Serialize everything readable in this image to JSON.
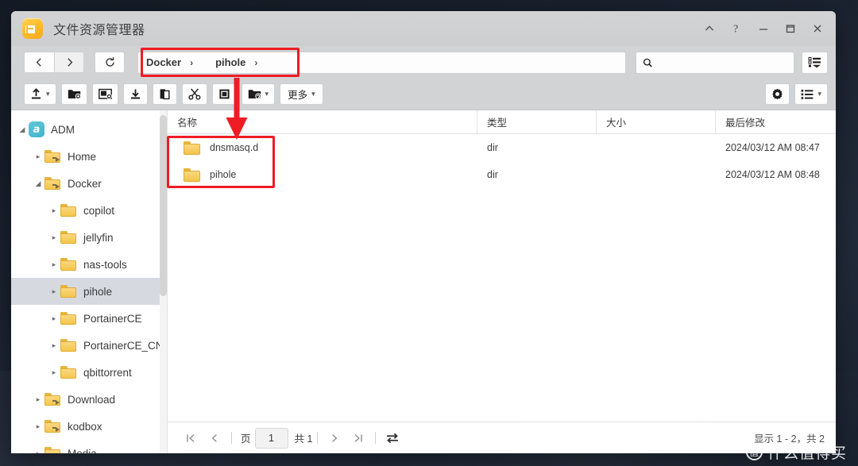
{
  "window": {
    "title": "文件资源管理器",
    "app_icon": "file-explorer-icon",
    "controls": {
      "collapse": "chevron-up-icon",
      "help": "help-icon",
      "minimize": "minimize-icon",
      "maximize": "maximize-icon",
      "close": "close-icon"
    }
  },
  "navbar": {
    "back": "back-icon",
    "forward": "forward-icon",
    "reload": "reload-icon",
    "breadcrumb": [
      {
        "label": "Docker",
        "sep": "›"
      },
      {
        "label": "pihole",
        "sep": "›"
      }
    ],
    "search": {
      "placeholder": "",
      "value": "",
      "icon": "search-icon"
    },
    "filter_button": "filter-list-icon"
  },
  "toolbar": {
    "buttons": [
      {
        "name": "upload",
        "icon": "upload-icon",
        "label": "",
        "caret": true
      },
      {
        "name": "new-folder",
        "icon": "new-folder-icon",
        "label": "",
        "caret": false
      },
      {
        "name": "new-shared-folder",
        "icon": "shared-folder-icon",
        "label": "",
        "caret": false
      },
      {
        "name": "download",
        "icon": "download-icon",
        "label": "",
        "caret": false
      },
      {
        "name": "copy",
        "icon": "copy-icon",
        "label": "",
        "caret": false
      },
      {
        "name": "cut",
        "icon": "scissors-icon",
        "label": "",
        "caret": false
      },
      {
        "name": "paste",
        "icon": "paste-icon",
        "label": "",
        "caret": false
      },
      {
        "name": "share",
        "icon": "share-icon",
        "label": "",
        "caret": true
      },
      {
        "name": "more",
        "icon": "",
        "label": "更多",
        "caret": true
      }
    ],
    "settings_button": "gear-icon",
    "view_button": "list-view-icon"
  },
  "sidebar": {
    "items": [
      {
        "label": "ADM",
        "indent": 0,
        "icon": "adm-icon",
        "twisty": "expanded",
        "selected": false
      },
      {
        "label": "Home",
        "indent": 1,
        "icon": "shared-folder-icon",
        "twisty": "collapsed",
        "selected": false
      },
      {
        "label": "Docker",
        "indent": 1,
        "icon": "shared-folder-icon",
        "twisty": "expanded",
        "selected": false
      },
      {
        "label": "copilot",
        "indent": 2,
        "icon": "folder-icon",
        "twisty": "collapsed",
        "selected": false
      },
      {
        "label": "jellyfin",
        "indent": 2,
        "icon": "folder-icon",
        "twisty": "collapsed",
        "selected": false
      },
      {
        "label": "nas-tools",
        "indent": 2,
        "icon": "folder-icon",
        "twisty": "collapsed",
        "selected": false
      },
      {
        "label": "pihole",
        "indent": 2,
        "icon": "folder-icon",
        "twisty": "collapsed",
        "selected": true
      },
      {
        "label": "PortainerCE",
        "indent": 2,
        "icon": "folder-icon",
        "twisty": "collapsed",
        "selected": false
      },
      {
        "label": "PortainerCE_CN",
        "indent": 2,
        "icon": "folder-icon",
        "twisty": "collapsed",
        "selected": false
      },
      {
        "label": "qbittorrent",
        "indent": 2,
        "icon": "folder-icon",
        "twisty": "collapsed",
        "selected": false
      },
      {
        "label": "Download",
        "indent": 1,
        "icon": "shared-folder-icon",
        "twisty": "collapsed",
        "selected": false
      },
      {
        "label": "kodbox",
        "indent": 1,
        "icon": "shared-folder-icon",
        "twisty": "collapsed",
        "selected": false
      },
      {
        "label": "Media",
        "indent": 1,
        "icon": "shared-folder-icon",
        "twisty": "collapsed",
        "selected": false
      }
    ]
  },
  "filelist": {
    "columns": [
      {
        "key": "name",
        "label": "名称"
      },
      {
        "key": "type",
        "label": "类型"
      },
      {
        "key": "size",
        "label": "大小"
      },
      {
        "key": "mtime",
        "label": "最后修改"
      }
    ],
    "rows": [
      {
        "name": "dnsmasq.d",
        "type": "dir",
        "size": "",
        "mtime": "2024/03/12 AM 08:47",
        "icon": "folder-icon"
      },
      {
        "name": "pihole",
        "type": "dir",
        "size": "",
        "mtime": "2024/03/12 AM 08:48",
        "icon": "folder-icon"
      }
    ]
  },
  "footer": {
    "first_page": "first-page-icon",
    "prev_page": "prev-page-icon",
    "page_label": "页",
    "page_value": "1",
    "total_pages": "共 1",
    "next_page": "next-page-icon",
    "last_page": "last-page-icon",
    "refresh": "refresh-icon",
    "status": "显示 1 - 2，共 2"
  },
  "watermark": {
    "text": "什么值得买",
    "mark": "值"
  },
  "annotations": {
    "color": "#ee1c25",
    "items": [
      {
        "name": "breadcrumb-highlight",
        "type": "box"
      },
      {
        "name": "filelist-highlight",
        "type": "box"
      },
      {
        "name": "pointer-arrow",
        "type": "arrow"
      }
    ]
  }
}
